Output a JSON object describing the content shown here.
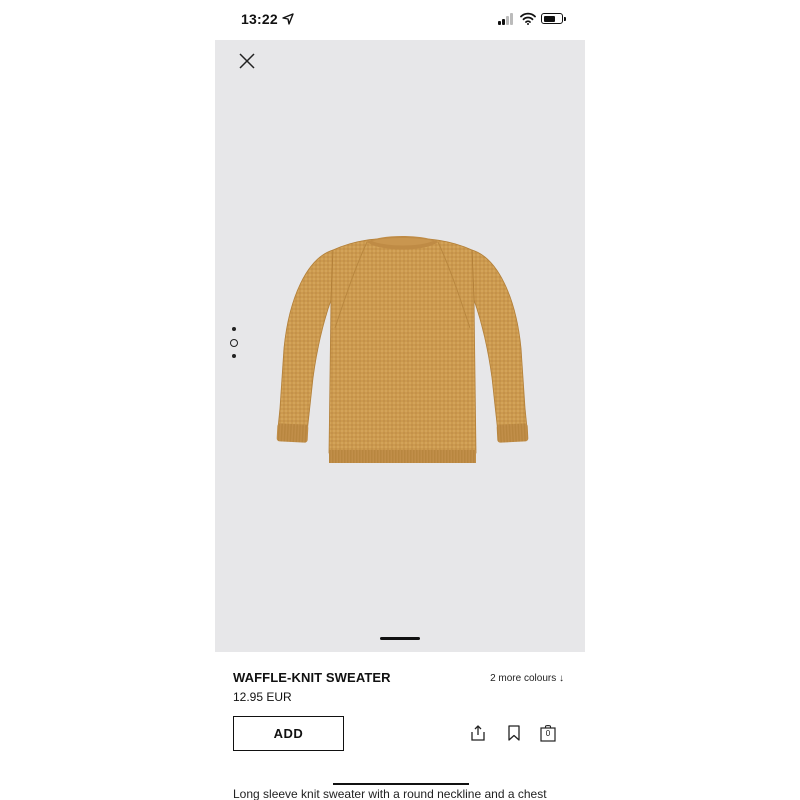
{
  "status_bar": {
    "time": "13:22"
  },
  "product": {
    "name": "WAFFLE-KNIT SWEATER",
    "price": "12.95 EUR",
    "more_colours": "2 more colours ↓",
    "description": "Long sleeve knit sweater with a round neckline and a chest"
  },
  "actions": {
    "add_label": "ADD",
    "bag_count": "0"
  },
  "icons": {
    "close": "close-icon",
    "share": "share-icon",
    "bookmark": "bookmark-icon",
    "bag": "shopping-bag-icon"
  },
  "colors": {
    "image_background": "#e7e7e9",
    "sweater": "#cc9a4e",
    "text": "#111111"
  },
  "gallery": {
    "image_count": 3,
    "current_index": 2
  }
}
